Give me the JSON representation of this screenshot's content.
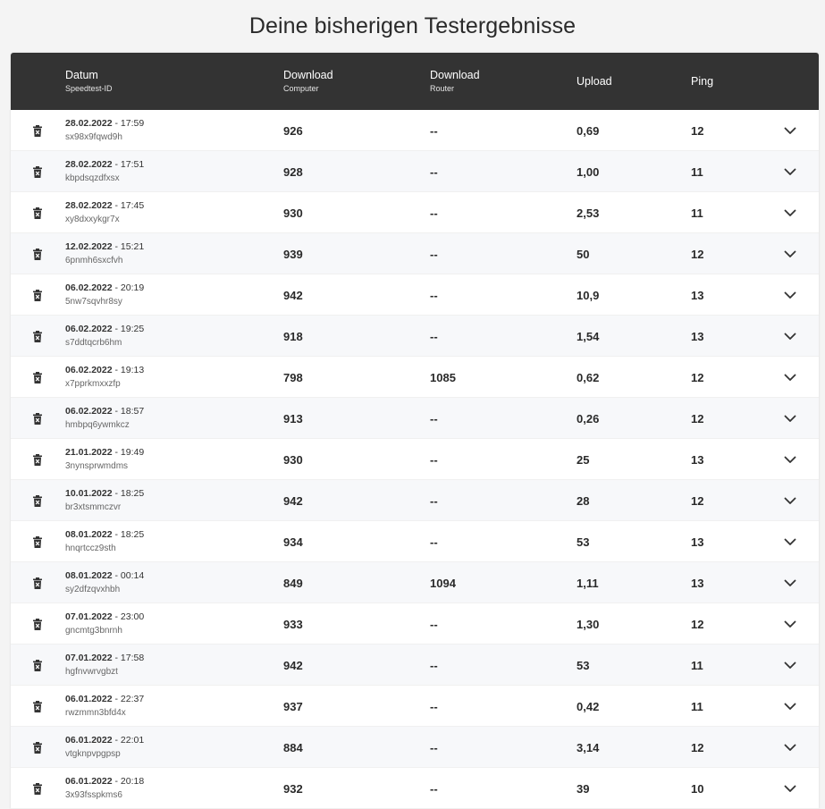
{
  "title": "Deine bisherigen Testergebnisse",
  "columns": {
    "date": {
      "label": "Datum",
      "sub": "Speedtest-ID"
    },
    "download_computer": {
      "label": "Download",
      "sub": "Computer"
    },
    "download_router": {
      "label": "Download",
      "sub": "Router"
    },
    "upload": {
      "label": "Upload"
    },
    "ping": {
      "label": "Ping"
    }
  },
  "icons": {
    "delete": "trash-icon",
    "expand": "chevron-down-icon"
  },
  "colors": {
    "header_bg": "#333333",
    "header_text": "#ffffff",
    "row_alt": "#f7f8fa"
  },
  "rows": [
    {
      "date": "28.02.2022",
      "time": " - 17:59",
      "id": "sx98x9fqwd9h",
      "dl_computer": "926",
      "dl_router": "--",
      "upload": "0,69",
      "ping": "12"
    },
    {
      "date": "28.02.2022",
      "time": " - 17:51",
      "id": "kbpdsqzdfxsx",
      "dl_computer": "928",
      "dl_router": "--",
      "upload": "1,00",
      "ping": "11"
    },
    {
      "date": "28.02.2022",
      "time": " - 17:45",
      "id": "xy8dxxykgr7x",
      "dl_computer": "930",
      "dl_router": "--",
      "upload": "2,53",
      "ping": "11"
    },
    {
      "date": "12.02.2022",
      "time": " - 15:21",
      "id": "6pnmh6sxcfvh",
      "dl_computer": "939",
      "dl_router": "--",
      "upload": "50",
      "ping": "12"
    },
    {
      "date": "06.02.2022",
      "time": " - 20:19",
      "id": "5nw7sqvhr8sy",
      "dl_computer": "942",
      "dl_router": "--",
      "upload": "10,9",
      "ping": "13"
    },
    {
      "date": "06.02.2022",
      "time": " - 19:25",
      "id": "s7ddtqcrb6hm",
      "dl_computer": "918",
      "dl_router": "--",
      "upload": "1,54",
      "ping": "13"
    },
    {
      "date": "06.02.2022",
      "time": " - 19:13",
      "id": "x7pprkmxxzfp",
      "dl_computer": "798",
      "dl_router": "1085",
      "upload": "0,62",
      "ping": "12"
    },
    {
      "date": "06.02.2022",
      "time": " - 18:57",
      "id": "hmbpq6ywmkcz",
      "dl_computer": "913",
      "dl_router": "--",
      "upload": "0,26",
      "ping": "12"
    },
    {
      "date": "21.01.2022",
      "time": " - 19:49",
      "id": "3nynsprwmdms",
      "dl_computer": "930",
      "dl_router": "--",
      "upload": "25",
      "ping": "13"
    },
    {
      "date": "10.01.2022",
      "time": " - 18:25",
      "id": "br3xtsmmczvr",
      "dl_computer": "942",
      "dl_router": "--",
      "upload": "28",
      "ping": "12"
    },
    {
      "date": "08.01.2022",
      "time": " - 18:25",
      "id": "hnqrtccz9sth",
      "dl_computer": "934",
      "dl_router": "--",
      "upload": "53",
      "ping": "13"
    },
    {
      "date": "08.01.2022",
      "time": " - 00:14",
      "id": "sy2dfzqvxhbh",
      "dl_computer": "849",
      "dl_router": "1094",
      "upload": "1,11",
      "ping": "13"
    },
    {
      "date": "07.01.2022",
      "time": " - 23:00",
      "id": "gncmtg3bnrnh",
      "dl_computer": "933",
      "dl_router": "--",
      "upload": "1,30",
      "ping": "12"
    },
    {
      "date": "07.01.2022",
      "time": " - 17:58",
      "id": "hgfnvwrvgbzt",
      "dl_computer": "942",
      "dl_router": "--",
      "upload": "53",
      "ping": "11"
    },
    {
      "date": "06.01.2022",
      "time": " - 22:37",
      "id": "rwzmmn3bfd4x",
      "dl_computer": "937",
      "dl_router": "--",
      "upload": "0,42",
      "ping": "11"
    },
    {
      "date": "06.01.2022",
      "time": " - 22:01",
      "id": "vtgknpvpgpsp",
      "dl_computer": "884",
      "dl_router": "--",
      "upload": "3,14",
      "ping": "12"
    },
    {
      "date": "06.01.2022",
      "time": " - 20:18",
      "id": "3x93fsspkms6",
      "dl_computer": "932",
      "dl_router": "--",
      "upload": "39",
      "ping": "10"
    }
  ]
}
